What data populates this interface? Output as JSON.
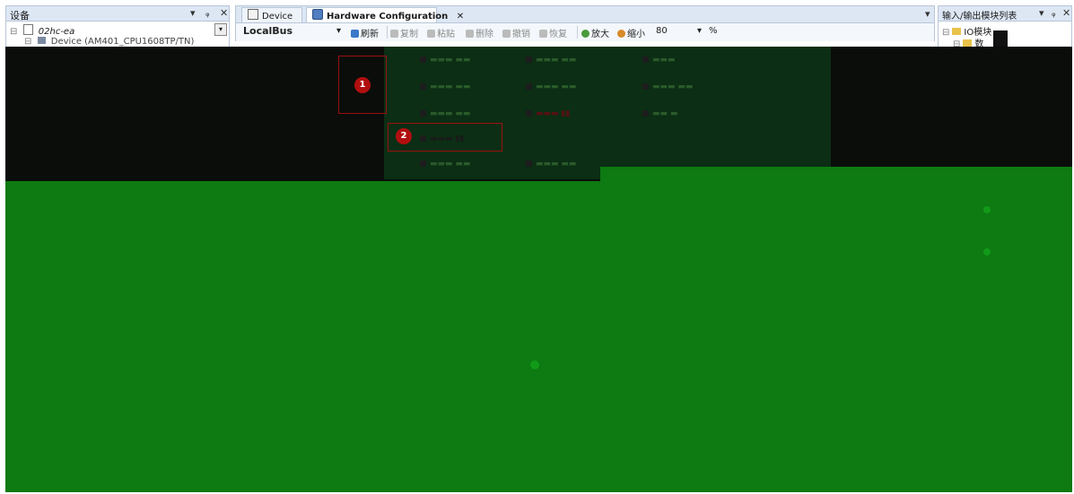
{
  "left_panel": {
    "title": "设备",
    "controls": {
      "dropdown": "▾",
      "pin": "ᵩ",
      "close": "✕"
    },
    "tree": [
      {
        "label": "02hc-ea"
      },
      {
        "label": "Device (AM401_CPU1608TP/TN)"
      }
    ]
  },
  "tabs": [
    {
      "label": "Device",
      "icon": "device-icon"
    },
    {
      "label": "Hardware Configuration",
      "icon": "hardware-config-icon",
      "close": "✕"
    }
  ],
  "tab_strip_dropdown": "▾",
  "toolbar": {
    "bus_select": "LocalBus",
    "bus_arrow": "▾",
    "refresh": "刷新",
    "copy": "复制",
    "paste": "粘贴",
    "delete": "删除",
    "undo": "撤销",
    "redo": "恢复",
    "zoom_in": "放大",
    "zoom_out": "缩小",
    "zoom_value": "80",
    "zoom_arrow": "▾",
    "zoom_unit": "%"
  },
  "right_panel": {
    "title": "输入/输出模块列表",
    "controls": {
      "dropdown": "▾",
      "pin": "ᵩ",
      "close": "✕"
    },
    "tree": [
      {
        "label": "IO模块"
      },
      {
        "label": "数"
      }
    ]
  },
  "markers": [
    "1",
    "2"
  ],
  "colors": {
    "panel_header": "#dde7f4",
    "marker_red": "#b10f0f",
    "green_overlay": "#0d7a12"
  }
}
